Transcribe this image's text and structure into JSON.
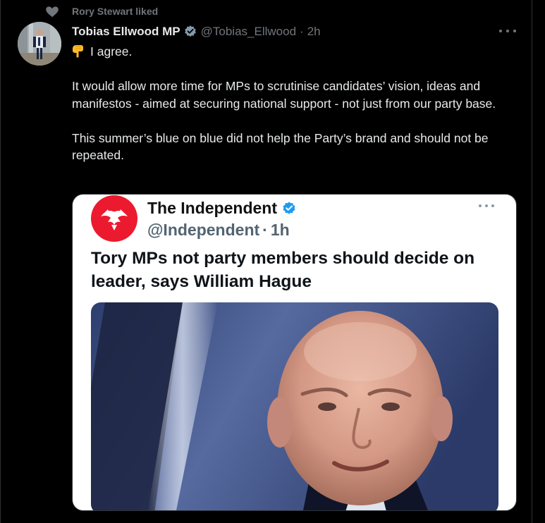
{
  "social_context": {
    "text": "Rory Stewart liked",
    "icon": "heart-icon"
  },
  "tweet": {
    "display_name": "Tobias Ellwood MP",
    "handle": "@Tobias_Ellwood",
    "separator": "·",
    "time": "2h",
    "first_line_emoji": "backhand-index-pointing-down-icon",
    "first_line": "I agree.",
    "paragraph_2": "It would allow more time for MPs to scrutinise candidates’ vision, ideas and manifestos - aimed at securing national support - not just from our party base.",
    "paragraph_3": "This summer’s blue on blue did not help the Party’s brand and should not be repeated."
  },
  "embedded": {
    "account_name": "The Independent",
    "account_handle": "@Independent",
    "separator": "·",
    "time": "1h",
    "headline": "Tory MPs not party members should decide on leader, says William Hague",
    "logo": "independent-eagle-logo"
  },
  "colors": {
    "background": "#000000",
    "primary_text": "#e7e9ea",
    "secondary_text": "#71767b",
    "verified": "#1d9bf0",
    "independent_red": "#ec1a2e"
  }
}
